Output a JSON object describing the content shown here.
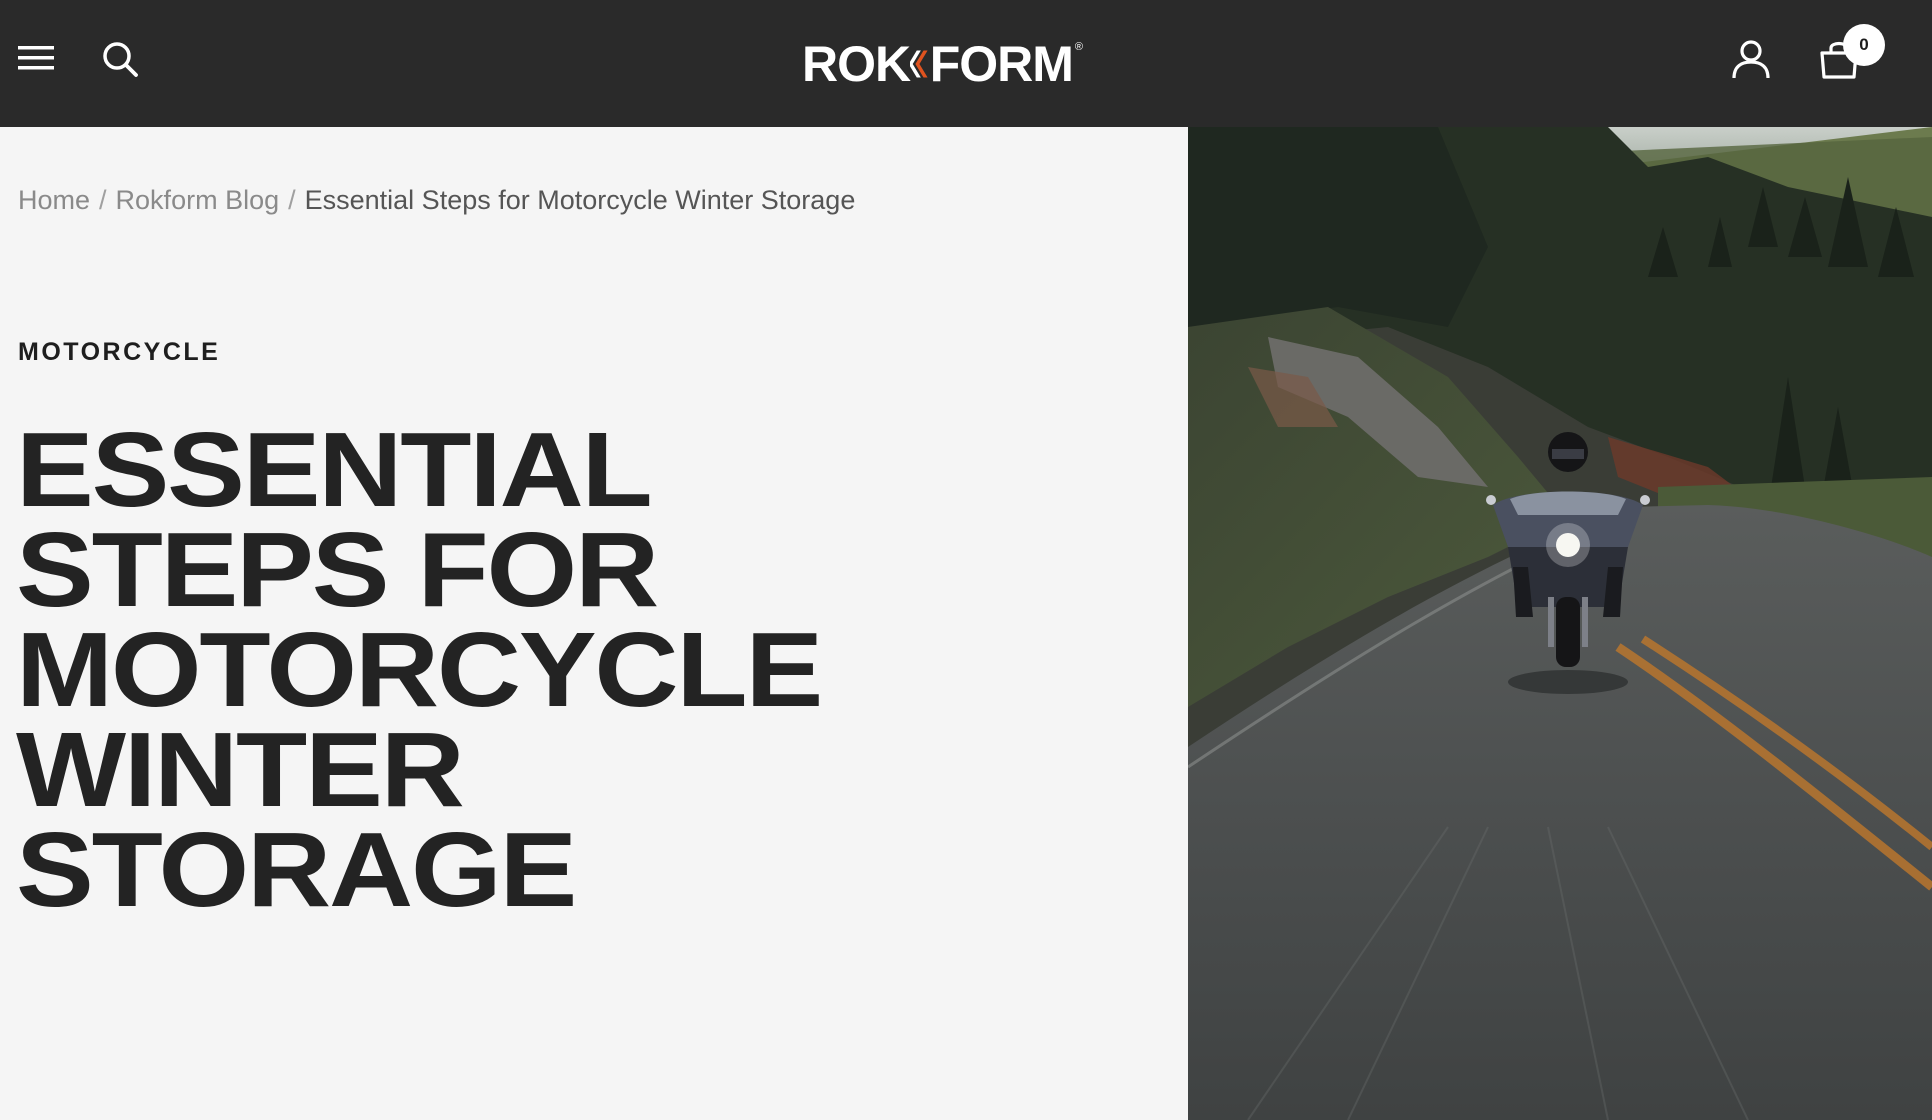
{
  "header": {
    "logo_text": "ROKFORM",
    "logo_registered": "®",
    "cart_count": "0",
    "icons": {
      "menu": "hamburger-menu-icon",
      "search": "search-icon",
      "account": "user-icon",
      "cart": "shopping-bag-icon"
    }
  },
  "breadcrumb": {
    "items": [
      "Home",
      "Rokform Blog",
      "Essential Steps for Motorcycle Winter Storage"
    ],
    "separator": "/"
  },
  "article": {
    "category": "MOTORCYCLE",
    "title_lines": [
      "ESSENTIAL",
      "STEPS FOR",
      "MOTORCYCLE",
      "WINTER",
      "STORAGE"
    ]
  },
  "colors": {
    "header_bg": "#2a2a2a",
    "page_bg": "#f5f5f5",
    "logo_accent": "#e0531f",
    "title_text": "#232323"
  }
}
